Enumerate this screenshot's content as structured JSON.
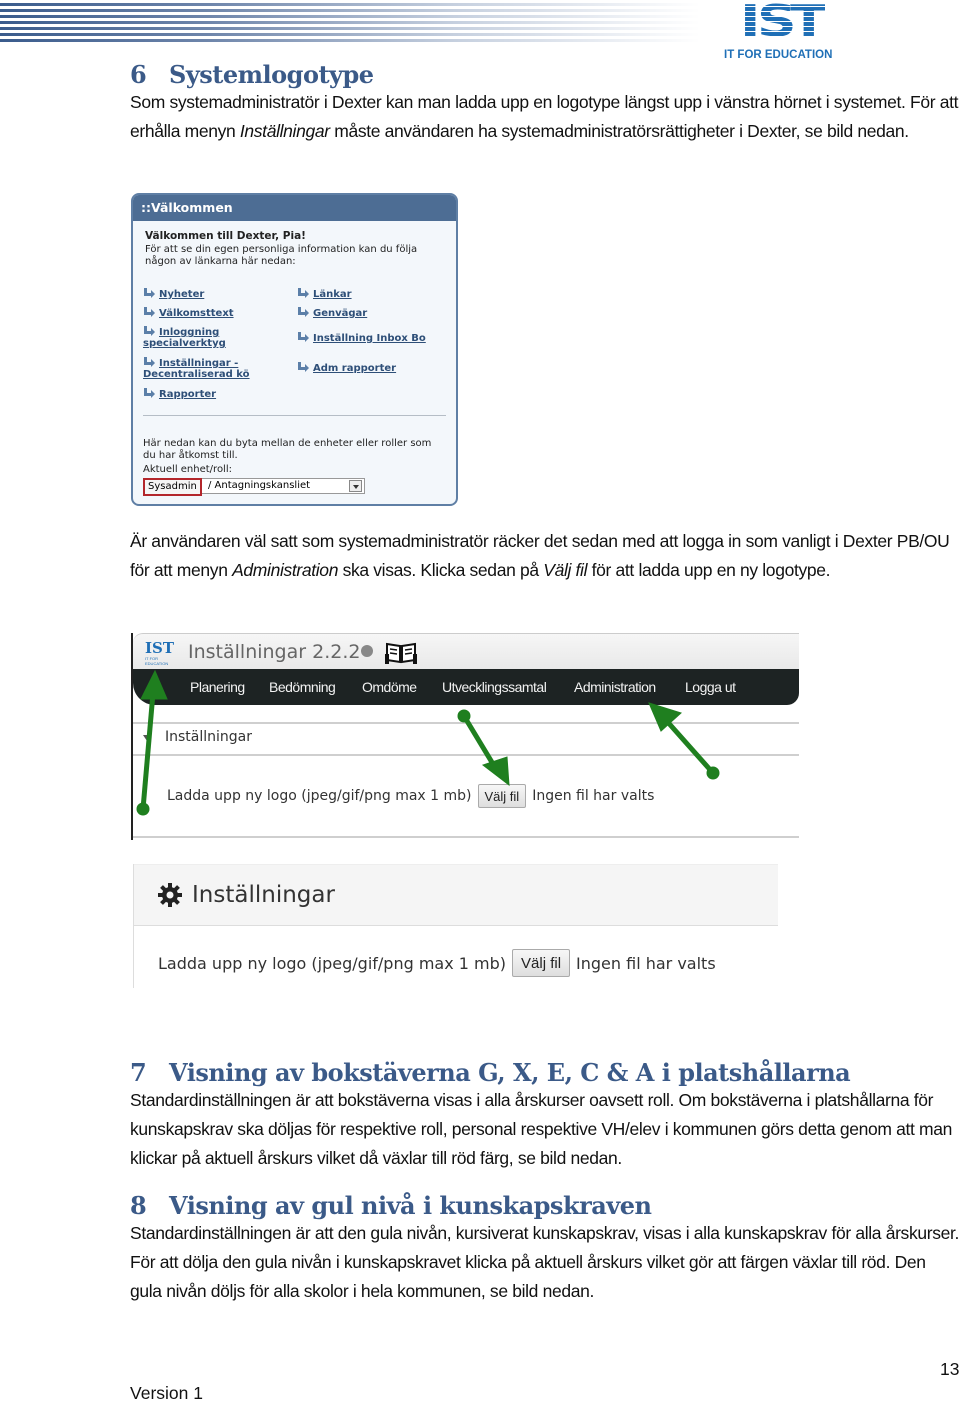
{
  "header": {
    "logo_letters": [
      "I",
      "S",
      "T"
    ],
    "logo_tagline": "IT FOR EDUCATION"
  },
  "section6": {
    "number": "6",
    "title": "Systemlogotype",
    "para1": {
      "before": "Som systemadministratör i Dexter kan man ladda upp en logotype längst upp i vänstra hörnet i systemet. För att erhålla menyn ",
      "italic": "Inställningar",
      "after": " måste användaren ha systemadministratörsrättigheter i Dexter, se bild nedan."
    },
    "para2": {
      "part1": "Är användaren väl satt som systemadministratör räcker det sedan med att logga in som vanligt i Dexter PB/OU för att menyn ",
      "italic1": "Administration",
      "part2": " ska visas. Klicka sedan på ",
      "italic2": "Välj fil",
      "part3": " för att ladda upp en ny logotype."
    }
  },
  "welcome_panel": {
    "header": "::Välkommen",
    "greeting": "Välkommen till Dexter, Pia!",
    "intro": "För att se din egen personliga information kan du följa någon av länkarna här nedan:",
    "links_left": [
      "Nyheter",
      "Välkomsttext",
      "Inloggning specialverktyg",
      "Inställningar - Decentraliserad kö",
      "Rapporter"
    ],
    "links_right": [
      "Länkar",
      "Genvägar",
      "Inställning Inbox Bo",
      "Adm rapporter"
    ],
    "switch_text": "Här nedan kan du byta mellan de enheter eller roller som du har åtkomst till.",
    "current_label": "Aktuell enhet/roll:",
    "role_value": "Sysadmin",
    "unit_value": "/ Antagningskansliet",
    "highlight_color": "#b3262b"
  },
  "old_settings": {
    "app_title": "Inställningar 2.2.2",
    "mini_logo": "IST",
    "mini_logo_tagline": "IT FOR EDUCATION",
    "nav": [
      "Planering",
      "Bedömning",
      "Omdöme",
      "Utvecklingssamtal",
      "Administration",
      "Logga ut"
    ],
    "section": "Inställningar",
    "upload_label": "Ladda upp ny logo (jpeg/gif/png max 1 mb)",
    "choose_file": "Välj fil",
    "no_file": "Ingen fil har valts",
    "arrow_color": "#1f7f1f"
  },
  "new_settings": {
    "title": "Inställningar",
    "upload_label": "Ladda upp ny logo (jpeg/gif/png max 1 mb)",
    "choose_file": "Välj fil",
    "no_file": "Ingen fil har valts"
  },
  "section7": {
    "number": "7",
    "title": "Visning av bokstäverna G, X, E, C & A i platshållarna",
    "text": "Standardinställningen är att bokstäverna visas i alla årskurser oavsett roll. Om bokstäverna i platshållarna för kunskapskrav ska döljas för respektive roll, personal respektive VH/elev i kommunen görs detta genom att man klickar på aktuell årskurs vilket då växlar till röd färg, se bild nedan."
  },
  "section8": {
    "number": "8",
    "title": "Visning av gul nivå i kunskapskraven",
    "text": "Standardinställningen är att den gula nivån, kursiverat kunskapskrav, visas i alla kunskapskrav för alla årskurser. För att dölja den gula nivån i kunskapskravet klicka på aktuell årskurs vilket gör att färgen växlar till röd. Den gula nivån döljs för alla skolor i hela kommunen, se bild nedan."
  },
  "footer": {
    "version": "Version 1",
    "page_number": "13"
  }
}
